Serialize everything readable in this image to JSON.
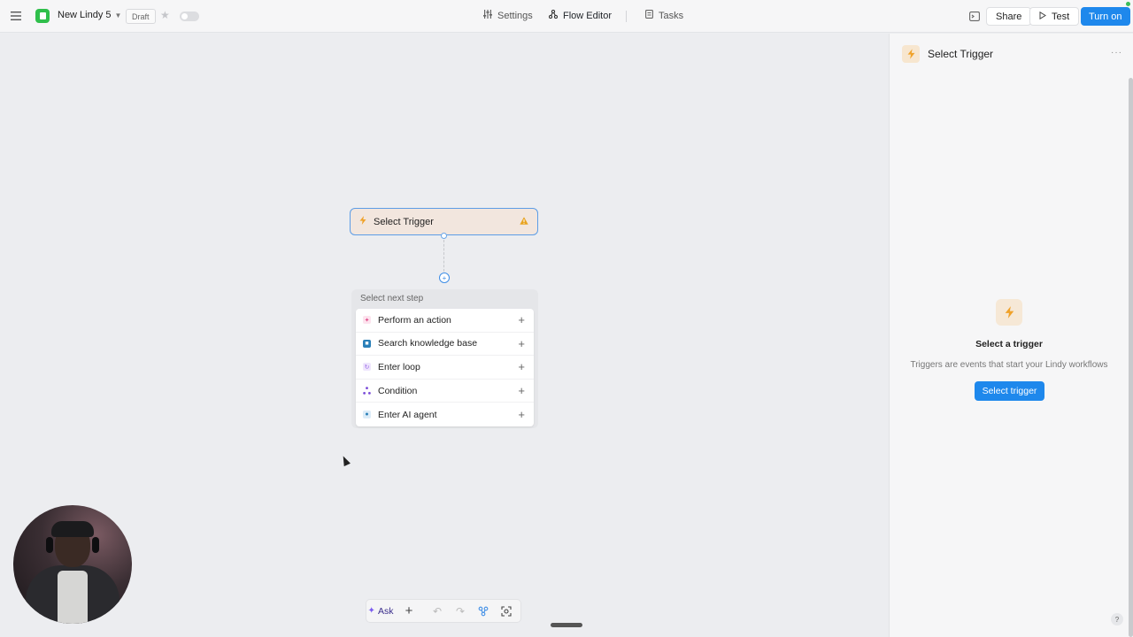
{
  "header": {
    "app_name": "New Lindy 5",
    "draft_label": "Draft",
    "nav": {
      "settings": "Settings",
      "flow_editor": "Flow Editor",
      "tasks": "Tasks"
    },
    "share_label": "Share",
    "test_label": "Test",
    "turn_on_label": "Turn on",
    "accent_color": "#1e88ec"
  },
  "canvas": {
    "trigger_node": {
      "label": "Select Trigger",
      "icon": "lightning-icon",
      "status_icon": "warning-icon"
    },
    "next_step": {
      "title": "Select next step",
      "items": [
        {
          "label": "Perform an action",
          "icon": "action-icon",
          "color": "#e04e8c"
        },
        {
          "label": "Search knowledge base",
          "icon": "knowledge-base-icon",
          "color": "#2a7fb8"
        },
        {
          "label": "Enter loop",
          "icon": "loop-icon",
          "color": "#9b6ae8"
        },
        {
          "label": "Condition",
          "icon": "condition-icon",
          "color": "#7a4bd8"
        },
        {
          "label": "Enter AI agent",
          "icon": "ai-agent-icon",
          "color": "#2a7fb8"
        }
      ]
    },
    "toolbar": {
      "ask_label": "Ask"
    }
  },
  "right_panel": {
    "title": "Select Trigger",
    "empty_title": "Select a trigger",
    "empty_description": "Triggers are events that start your Lindy workflows",
    "button_label": "Select trigger",
    "help_label": "?"
  }
}
